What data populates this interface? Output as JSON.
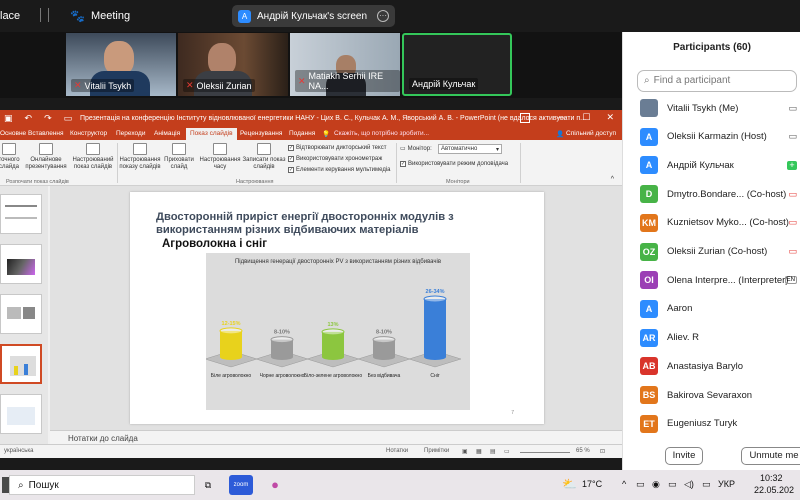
{
  "zoom": {
    "app_label": "lace",
    "meeting_label": "Meeting",
    "screen_share_label": "Андрій Кульчак's screen",
    "screen_avatar_initial": "A"
  },
  "videos": [
    {
      "name": "Vitalii Tsykh"
    },
    {
      "name": "Oleksii Zurian"
    },
    {
      "name": "Matiakh Serhii IRE NA..."
    },
    {
      "name": "Андрій Кульчак"
    }
  ],
  "ppt": {
    "title": "Презентація на конференцію Інституту відновлюваної енергетики НАНУ - Цих В. С., Кульчак А. М., Яворський А. В. - PowerPoint (не вдалося активувати п...",
    "tabs": [
      "Основне",
      "Вставлення",
      "Конструктор",
      "Переходи",
      "Анімація",
      "Показ слайдів",
      "Рецензування",
      "Подання"
    ],
    "active_tab": "Показ слайдів",
    "tell_me": "Скажіть, що потрібно зробити...",
    "share_label": "Спільний доступ",
    "ribbon": {
      "btn_from_current": "точного слайда",
      "btn_online": "Онлайнове презентування",
      "btn_custom": "Настроюваний показ слайдів",
      "group_start": "Розпочати показ слайдів",
      "btn_setup": "Настроювання показу слайдів",
      "btn_hide": "Приховати слайд",
      "btn_rehearse": "Настроювання часу",
      "btn_record": "Записати показ слайдів",
      "chk_narration": "Відтворювати дикторський текст",
      "chk_timings": "Використовувати хронометраж",
      "chk_media": "Елементи керування мультимедіа",
      "group_setup": "Настроювання",
      "monitor_label": "Монітор:",
      "monitor_value": "Автоматично",
      "chk_presenter": "Використовувати режим доповідача",
      "group_monitors": "Монітори"
    },
    "slide": {
      "title": "Двосторонній приріст енергії двосторонніх модулів з використанням різних відбиваючих матеріалів",
      "subtitle": "Агроволокна і сніг",
      "page_number": "7"
    },
    "notes_label": "Нотатки до слайда",
    "status": {
      "language": "українська",
      "notes": "Нотатки",
      "comments": "Примітки",
      "zoom": "65 %"
    }
  },
  "chart_data": {
    "type": "bar",
    "title": "Підвищення генерації двосторонніх PV з використанням різних відбивачів",
    "categories": [
      "Біле агроволокно",
      "Чорне агроволокно",
      "Біло-зелене агроволокно",
      "Без відбивача",
      "Сніг"
    ],
    "labels": [
      "12-15%",
      "8-10%",
      "13%",
      "8-10%",
      "26-34%"
    ],
    "values": [
      13.5,
      9,
      13,
      9,
      30
    ],
    "colors": [
      "#e8d21c",
      "#9a9a9a",
      "#8cc63f",
      "#9a9a9a",
      "#3a7fd8"
    ]
  },
  "participants": {
    "header": "Participants (60)",
    "search_placeholder": "Find a participant",
    "items": [
      {
        "initials": "",
        "name": "Vitalii Tsykh (Me)",
        "color": "#6a7d94"
      },
      {
        "initials": "A",
        "name": "Oleksii Karmazin (Host)",
        "color": "#2d8cff"
      },
      {
        "initials": "A",
        "name": "Андрій Кульчак",
        "color": "#2d8cff"
      },
      {
        "initials": "D",
        "name": "Dmytro.Bondare... (Co-host)",
        "color": "#47b347"
      },
      {
        "initials": "KM",
        "name": "Kuznietsov Myko... (Co-host)",
        "color": "#e2761b"
      },
      {
        "initials": "OZ",
        "name": "Oleksii Zurian (Co-host)",
        "color": "#47b347"
      },
      {
        "initials": "OI",
        "name": "Olena Interpre... (Interpreter)",
        "color": "#9b3fb5"
      },
      {
        "initials": "A",
        "name": "Aaron",
        "color": "#2d8cff"
      },
      {
        "initials": "AR",
        "name": "Aliev. R",
        "color": "#2d8cff"
      },
      {
        "initials": "AB",
        "name": "Anastasiya Barylo",
        "color": "#d9342b"
      },
      {
        "initials": "BS",
        "name": "Bakirova Sevaraxon",
        "color": "#e2761b"
      },
      {
        "initials": "ET",
        "name": "Eugeniusz Turyk",
        "color": "#e2761b"
      }
    ],
    "interpreter_badge": "EN",
    "invite_label": "Invite",
    "unmute_label": "Unmute me"
  },
  "taskbar": {
    "search_label": "Пошук",
    "weather": "17°C",
    "language": "УКР",
    "time": "10:32",
    "date": "22.05.202"
  }
}
